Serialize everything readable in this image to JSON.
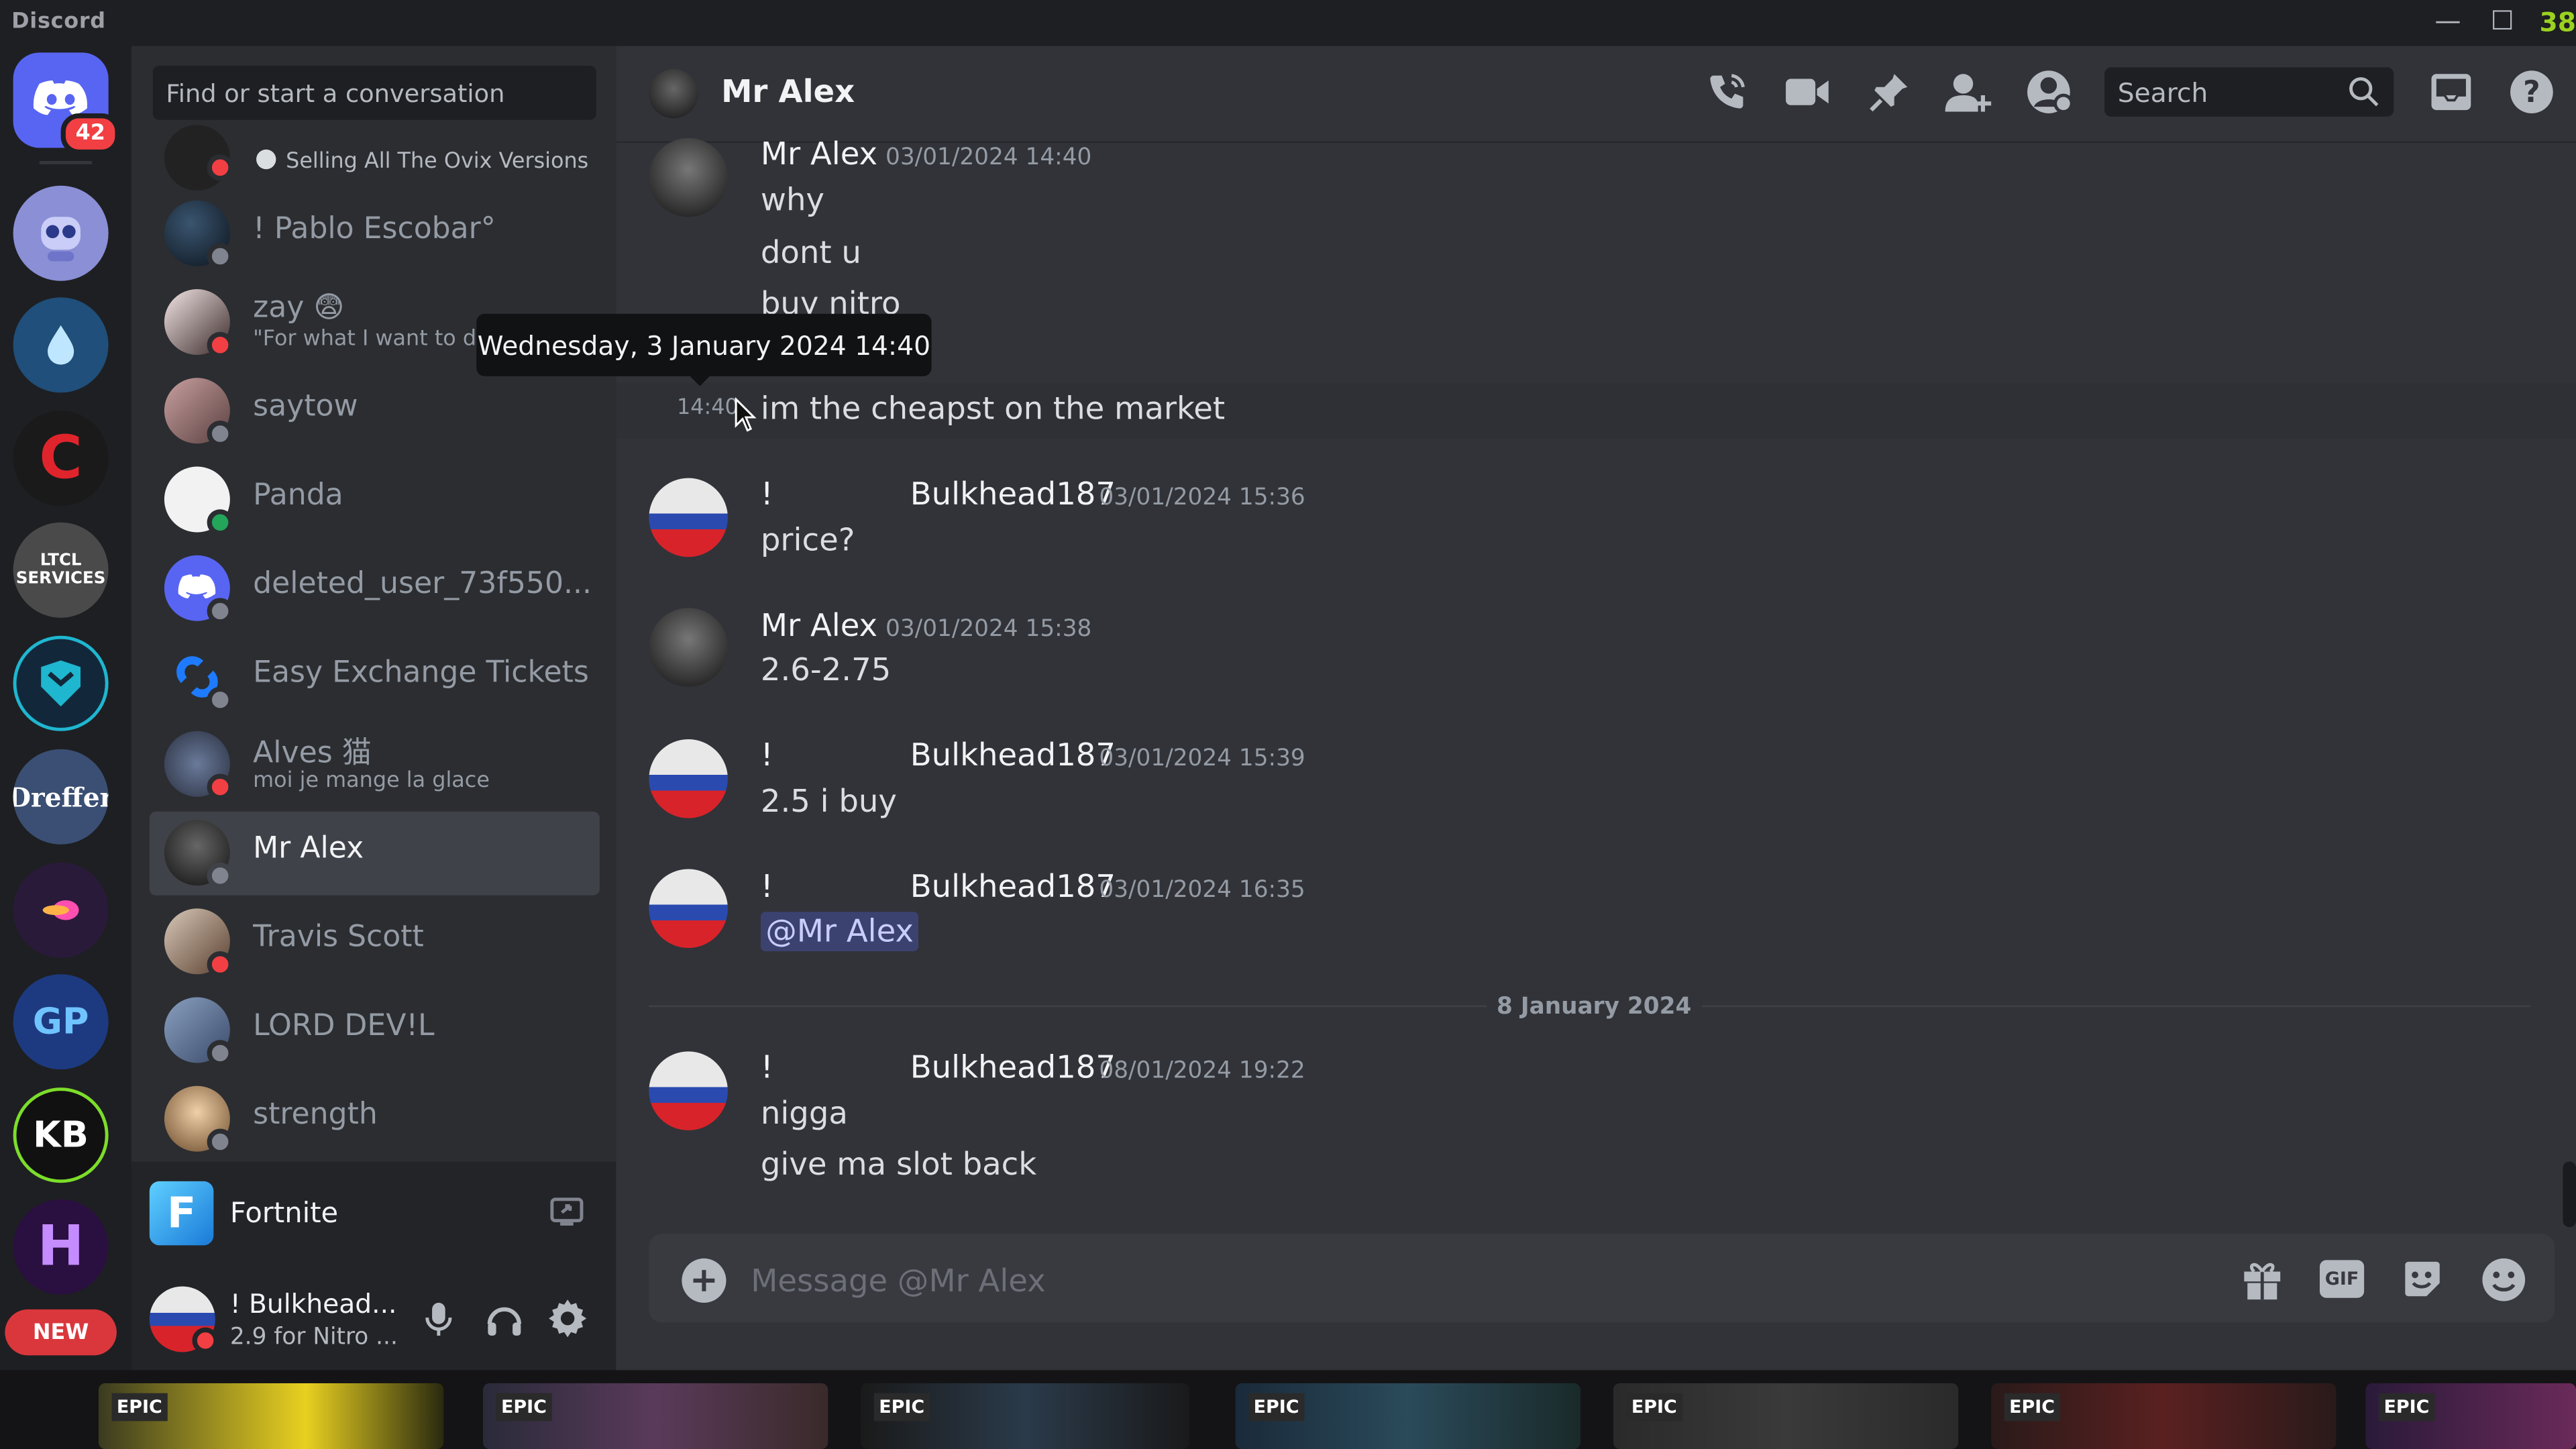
{
  "app": {
    "title": "Discord",
    "fps_counter": "38"
  },
  "servers": {
    "dm_badge": "42",
    "items": [
      {
        "name": "Direct Messages",
        "initials": "",
        "color": "#5865f2"
      },
      {
        "name": "Server 1",
        "initials": "",
        "color": "#8a8fd6"
      },
      {
        "name": "Server 2",
        "initials": "",
        "color": "#1f4f7a"
      },
      {
        "name": "Server 3",
        "initials": "C",
        "color": "#1a1a1a"
      },
      {
        "name": "LTCL SERVICES",
        "initials": "LTCL SERVICES",
        "color": "#4a4a4a"
      },
      {
        "name": "Server 5",
        "initials": "",
        "color": "#12283a"
      },
      {
        "name": "Dreffer",
        "initials": "Dreffer",
        "color": "#3a4f73"
      },
      {
        "name": "Server 7",
        "initials": "",
        "color": "#2a1a3a"
      },
      {
        "name": "GP",
        "initials": "GP",
        "color": "#1d3a80"
      },
      {
        "name": "KB",
        "initials": "KB",
        "color": "#111"
      },
      {
        "name": "H",
        "initials": "H",
        "color": "#2a1040"
      }
    ],
    "new_label": "NEW"
  },
  "dm_sidebar": {
    "search_placeholder": "Find or start a conversation",
    "dms": [
      {
        "name": "",
        "sub": "Selling All The Ovix Versions",
        "status": "dnd",
        "color": "#222"
      },
      {
        "name": "! Pablo Escobar°",
        "sub": "",
        "status": "off",
        "color": "#1c2a38"
      },
      {
        "name": "zay 😨",
        "sub": "\"For what I want to do",
        "status": "dnd",
        "color": "#3a2a2a"
      },
      {
        "name": "saytow",
        "sub": "",
        "status": "off",
        "color": "#7a5a5a"
      },
      {
        "name": "Panda",
        "sub": "",
        "status": "on",
        "color": "#f2f2f2"
      },
      {
        "name": "deleted_user_73f550...",
        "sub": "",
        "status": "off",
        "color": "#5865f2"
      },
      {
        "name": "Easy Exchange Tickets",
        "sub": "",
        "status": "off",
        "color": "#2b2d31"
      },
      {
        "name": "Alves 猫",
        "sub": "moi je mange la glace",
        "status": "dnd",
        "color": "#4a5a7a"
      },
      {
        "name": "Mr Alex",
        "sub": "",
        "status": "off",
        "color": "#222"
      },
      {
        "name": "Travis Scott",
        "sub": "",
        "status": "dnd",
        "color": "#5a4030"
      },
      {
        "name": "LORD DEV!L",
        "sub": "",
        "status": "off",
        "color": "#3a4a6a"
      },
      {
        "name": "strength",
        "sub": "",
        "status": "off",
        "color": "#8a6a4a"
      }
    ]
  },
  "activity": {
    "game": "Fortnite"
  },
  "user_panel": {
    "name": "! Bulkhead...",
    "status": "2.9 for Nitro ..."
  },
  "header": {
    "title": "Mr Alex",
    "search_placeholder": "Search"
  },
  "tooltip": {
    "text": "Wednesday, 3 January 2024 14:40"
  },
  "messages": {
    "m1": {
      "author": "Mr Alex",
      "time": "03/01/2024 14:40",
      "lines": [
        "why",
        "dont u",
        "buy nitro"
      ]
    },
    "m1_follow": {
      "time": "14:40",
      "text": "im the cheapst on the market"
    },
    "m2": {
      "prefix": "!",
      "author": "Bulkhead187",
      "time": "03/01/2024 15:36",
      "text": "price?"
    },
    "m3": {
      "author": "Mr Alex",
      "time": "03/01/2024 15:38",
      "text": "2.6-2.75"
    },
    "m4": {
      "prefix": "!",
      "author": "Bulkhead187",
      "time": "03/01/2024 15:39",
      "text": "2.5 i buy"
    },
    "m5": {
      "prefix": "!",
      "author": "Bulkhead187",
      "time": "03/01/2024 16:35",
      "mention": "@Mr Alex"
    },
    "divider": "8 January 2024",
    "m6": {
      "prefix": "!",
      "author": "Bulkhead187",
      "time": "08/01/2024 19:22",
      "lines": [
        "nigga",
        "give ma slot back"
      ]
    }
  },
  "composer": {
    "placeholder": "Message @Mr Alex",
    "gif_label": "GIF"
  },
  "taskbar": {
    "labels": [
      "EPIC",
      "EPIC",
      "EPIC",
      "EPIC",
      "EPIC",
      "EPIC",
      "EPIC"
    ]
  }
}
